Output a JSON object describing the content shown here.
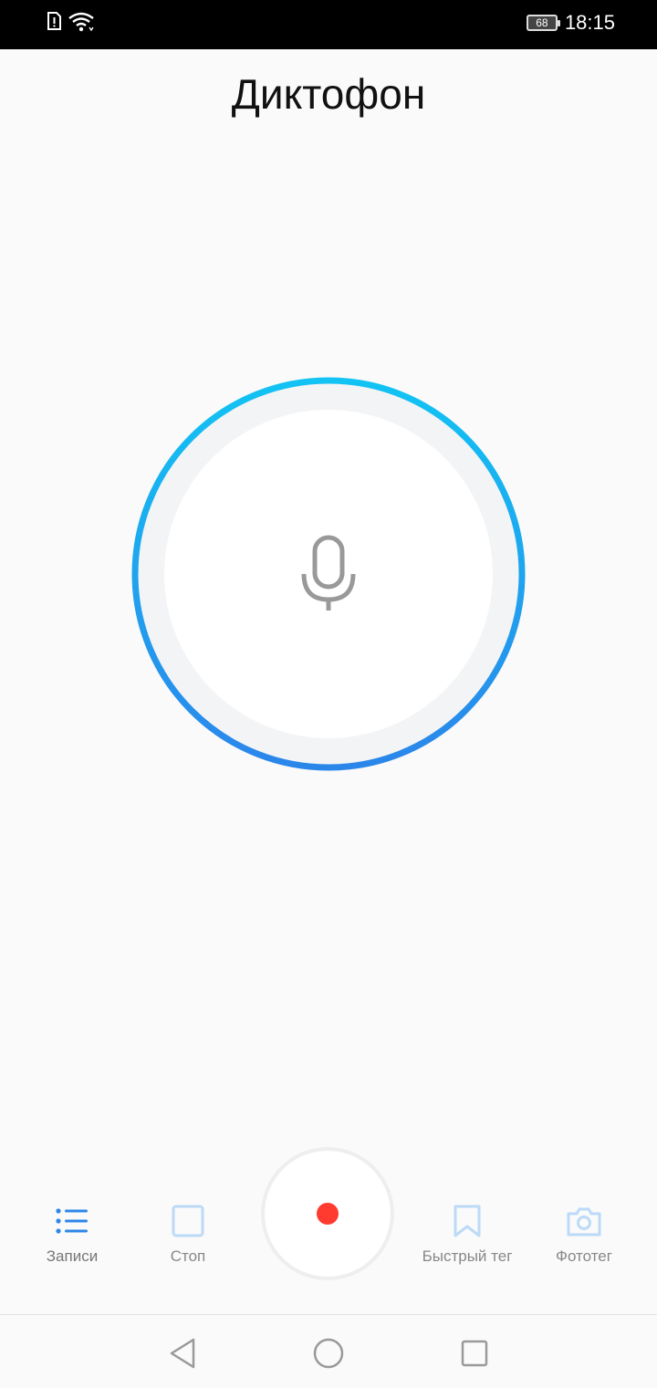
{
  "status_bar": {
    "time": "18:15",
    "battery_level": "68",
    "icons": [
      "sim-alert-icon",
      "wifi-icon",
      "battery-icon"
    ]
  },
  "header": {
    "title": "Диктофон"
  },
  "recorder": {
    "mic_icon": "microphone-icon",
    "ring_colors": [
      "#12c3f3",
      "#2b86ea"
    ]
  },
  "actions": {
    "records": {
      "label": "Записи",
      "icon": "list-icon",
      "color": "#2f86e8"
    },
    "stop": {
      "label": "Стоп",
      "icon": "stop-icon",
      "color": "#bcdaf7"
    },
    "quick_tag": {
      "label": "Быстрый тег",
      "icon": "bookmark-icon",
      "color": "#bcdaf7"
    },
    "photo_tag": {
      "label": "Фототег",
      "icon": "camera-icon",
      "color": "#bcdaf7"
    }
  },
  "record_button": {
    "icon": "record-dot-icon",
    "color": "#ff3b30"
  },
  "navigation": {
    "buttons": [
      "back-icon",
      "home-icon",
      "recents-icon"
    ]
  }
}
